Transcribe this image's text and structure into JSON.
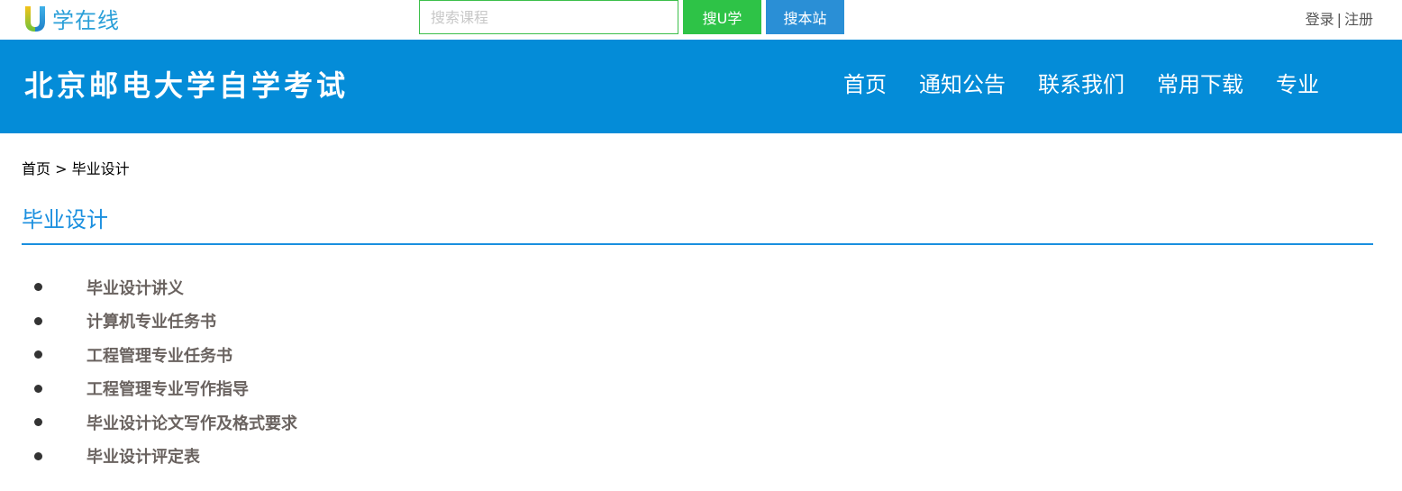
{
  "header": {
    "logo_text": "学在线",
    "search": {
      "placeholder": "搜索课程",
      "value": ""
    },
    "btn_uxue": "搜U学",
    "btn_site": "搜本站",
    "login": "登录",
    "separator": "|",
    "register": "注册"
  },
  "banner": {
    "title": "北京邮电大学自学考试",
    "nav": [
      "首页",
      "通知公告",
      "联系我们",
      "常用下载",
      "专业"
    ]
  },
  "breadcrumb": {
    "home": "首页",
    "sep": ">",
    "current": "毕业设计"
  },
  "main": {
    "title": "毕业设计",
    "items": [
      "毕业设计讲义",
      "计算机专业任务书",
      "工程管理专业任务书",
      "工程管理专业写作指导",
      "毕业设计论文写作及格式要求",
      "毕业设计评定表"
    ]
  },
  "colors": {
    "banner_bg": "#048cd8",
    "accent_blue": "#1a8fdf",
    "search_green": "#2ec347",
    "search_blue": "#2a8fd6"
  }
}
